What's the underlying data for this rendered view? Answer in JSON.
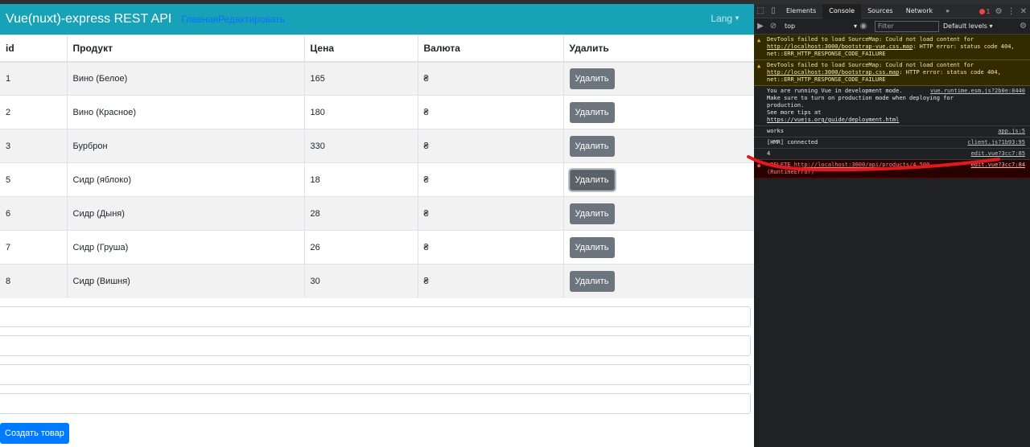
{
  "navbar": {
    "brand": "Vue(nuxt)-express REST API",
    "links": [
      "Главная",
      "Редактировать"
    ],
    "lang_label": "Lang"
  },
  "table": {
    "headers": [
      "id",
      "Продукт",
      "Цена",
      "Валюта",
      "Удалить"
    ],
    "rows": [
      {
        "id": "1",
        "product": "Вино (Белое)",
        "price": "165",
        "currency": "₴",
        "action": "Удалить"
      },
      {
        "id": "2",
        "product": "Вино (Красное)",
        "price": "180",
        "currency": "₴",
        "action": "Удалить"
      },
      {
        "id": "3",
        "product": "Бурброн",
        "price": "330",
        "currency": "₴",
        "action": "Удалить"
      },
      {
        "id": "5",
        "product": "Сидр (яблоко)",
        "price": "18",
        "currency": "₴",
        "action": "Удалить"
      },
      {
        "id": "6",
        "product": "Сидр (Дыня)",
        "price": "28",
        "currency": "₴",
        "action": "Удалить"
      },
      {
        "id": "7",
        "product": "Сидр (Груша)",
        "price": "26",
        "currency": "₴",
        "action": "Удалить"
      },
      {
        "id": "8",
        "product": "Сидр (Вишня)",
        "price": "30",
        "currency": "₴",
        "action": "Удалить"
      }
    ]
  },
  "create_button": "Создать товар",
  "devtools": {
    "tabs": [
      "Elements",
      "Console",
      "Sources",
      "Network"
    ],
    "active_tab": "Console",
    "more_tabs": "»",
    "error_count": "1",
    "context": "top",
    "filter_placeholder": "Filter",
    "levels": "Default levels",
    "messages": [
      {
        "type": "warn",
        "lines": [
          "DevTools failed to load SourceMap: Could not load content for ",
          "http://localhost:3000/bootstrap-vue.css.map",
          ": HTTP error: status code 404, net::ERR_HTTP_RESPONSE_CODE_FAILURE"
        ],
        "source": ""
      },
      {
        "type": "warn",
        "lines": [
          "DevTools failed to load SourceMap: Could not load content for ",
          "http://localhost:3000/bootstrap.css.map",
          ": HTTP error: status code 404, net::ERR_HTTP_RESPONSE_CODE_FAILURE"
        ],
        "source": ""
      },
      {
        "type": "log",
        "lines": [
          "You are running Vue in development mode.\nMake sure to turn on production mode when deploying for production.\nSee more tips at ",
          "https://vuejs.org/guide/deployment.html",
          ""
        ],
        "source": "vue.runtime.esm.js?2b0e:8440"
      },
      {
        "type": "log",
        "lines": [
          "works",
          "",
          ""
        ],
        "source": "app.js:5"
      },
      {
        "type": "log",
        "lines": [
          "[HMR] connected",
          "",
          ""
        ],
        "source": "client.js?1b93:95"
      },
      {
        "type": "log",
        "lines": [
          "4",
          "",
          ""
        ],
        "source": "edit.vue?3cc7:85"
      },
      {
        "type": "error",
        "lines": [
          "▸DELETE ",
          "http://localhost:3000/api/products/4",
          " 500\n(RuntimeError)"
        ],
        "source": "edit.vue?3cc7:84"
      }
    ]
  },
  "colors": {
    "navbar": "#17a2b8",
    "link": "#0d6efd",
    "delete_button": "#6c757d",
    "create_button": "#007bff",
    "annotation": "#e0191c"
  }
}
